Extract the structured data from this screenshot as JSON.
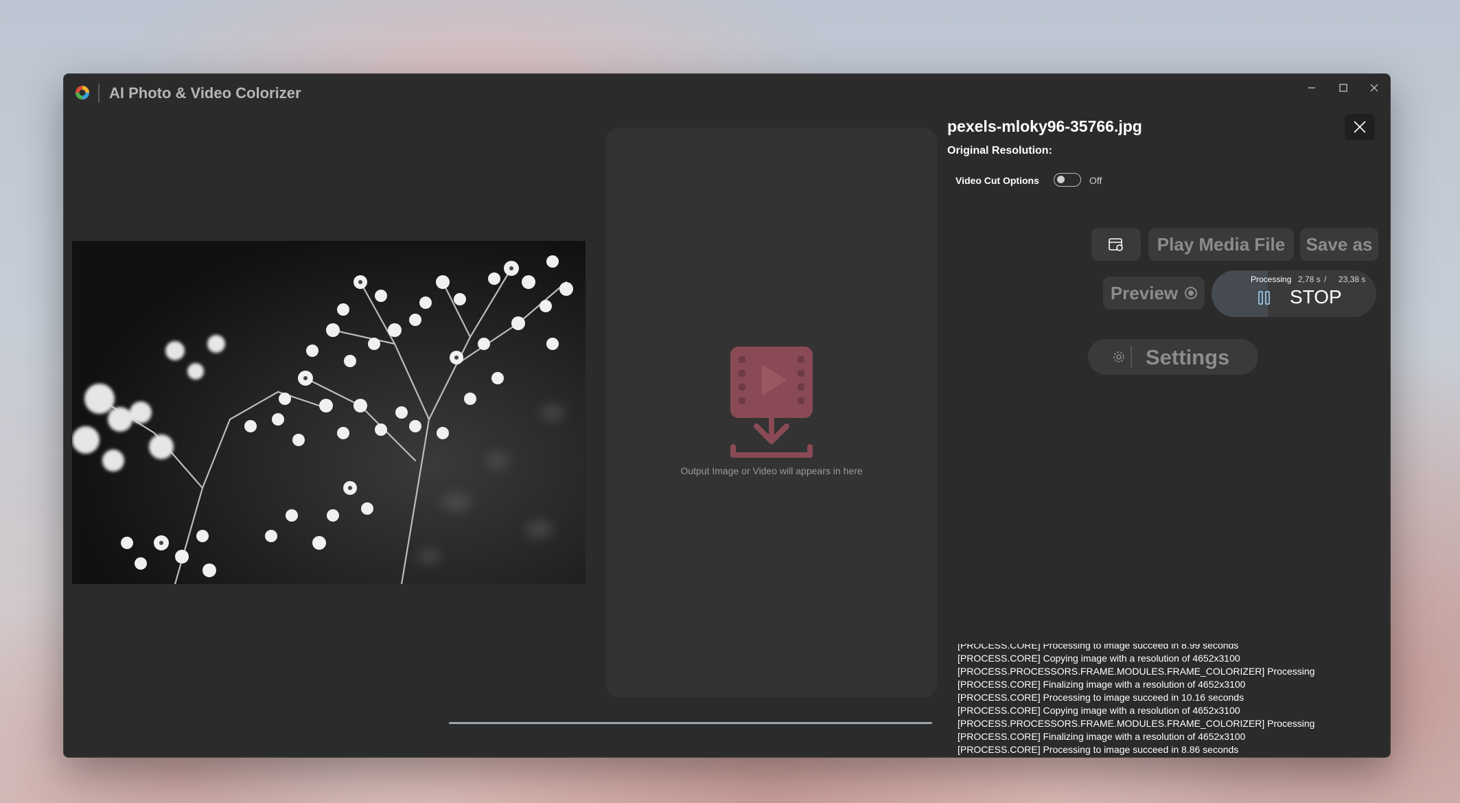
{
  "window": {
    "title": "AI Photo & Video Colorizer",
    "controls": {
      "minimize": "—",
      "maximize": "□",
      "close": "✕"
    }
  },
  "output": {
    "placeholder_text": "Output Image or Video will appears in here",
    "icon": "video-download-icon",
    "accent": "#8a4a55"
  },
  "info": {
    "filename": "pexels-mloky96-35766.jpg",
    "resolution_label": "Original Resolution:",
    "video_cut_label": "Video Cut Options",
    "video_cut_state": "Off"
  },
  "actions": {
    "play_label": "Play Media File",
    "save_label": "Save as",
    "preview_label": "Preview",
    "settings_label": "Settings"
  },
  "processing": {
    "status": "Processing",
    "elapsed": "2,78 s",
    "separator": "/",
    "total": "23,38 s",
    "stop_label": "STOP",
    "progress_fraction": 0.12
  },
  "log": [
    "[PROCESS.CORE] Processing to image succeed in 8.99 seconds",
    "[PROCESS.CORE] Copying image with a resolution of 4652x3100",
    "[PROCESS.PROCESSORS.FRAME.MODULES.FRAME_COLORIZER] Processing",
    "[PROCESS.CORE] Finalizing image with a resolution of 4652x3100",
    "[PROCESS.CORE] Processing to image succeed in 10.16 seconds",
    "[PROCESS.CORE] Copying image with a resolution of 4652x3100",
    "[PROCESS.PROCESSORS.FRAME.MODULES.FRAME_COLORIZER] Processing",
    "[PROCESS.CORE] Finalizing image with a resolution of 4652x3100",
    "[PROCESS.CORE] Processing to image succeed in 8.86 seconds"
  ]
}
